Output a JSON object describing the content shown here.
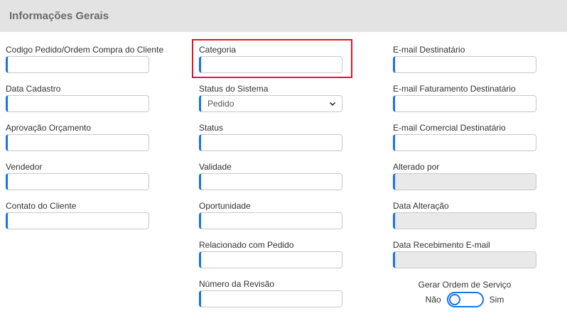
{
  "section": {
    "title": "Informações Gerais"
  },
  "col1": [
    {
      "label": "Codigo Pedido/Ordem Compra do Cliente",
      "value": ""
    },
    {
      "label": "Data Cadastro",
      "value": ""
    },
    {
      "label": "Aprovação Orçamento",
      "value": ""
    },
    {
      "label": "Vendedor",
      "value": ""
    },
    {
      "label": "Contato do Cliente",
      "value": ""
    }
  ],
  "col2": [
    {
      "label": "Categoria",
      "value": ""
    },
    {
      "label": "Status do Sistema",
      "value": "Pedido"
    },
    {
      "label": "Status",
      "value": ""
    },
    {
      "label": "Validade",
      "value": ""
    },
    {
      "label": "Oportunidade",
      "value": ""
    },
    {
      "label": "Relacionado com Pedido",
      "value": ""
    },
    {
      "label": "Número da Revisão",
      "value": ""
    }
  ],
  "col3": [
    {
      "label": "E-mail Destinatário",
      "value": ""
    },
    {
      "label": "E-mail Faturamento Destinatário",
      "value": ""
    },
    {
      "label": "E-mail Comercial Destinatário",
      "value": ""
    },
    {
      "label": "Alterado por",
      "value": ""
    },
    {
      "label": "Data Alteração",
      "value": ""
    },
    {
      "label": "Data Recebimento E-mail",
      "value": ""
    }
  ],
  "toggle": {
    "title": "Gerar Ordem de Serviço",
    "off_label": "Não",
    "on_label": "Sim",
    "state": "off"
  },
  "colors": {
    "accent": "#1a73e8",
    "highlight": "#e0171e",
    "header_bg": "#e3e3e3",
    "disabled_bg": "#e9e9e9"
  },
  "icons": {
    "select_arrow": "chevron-down-icon"
  }
}
